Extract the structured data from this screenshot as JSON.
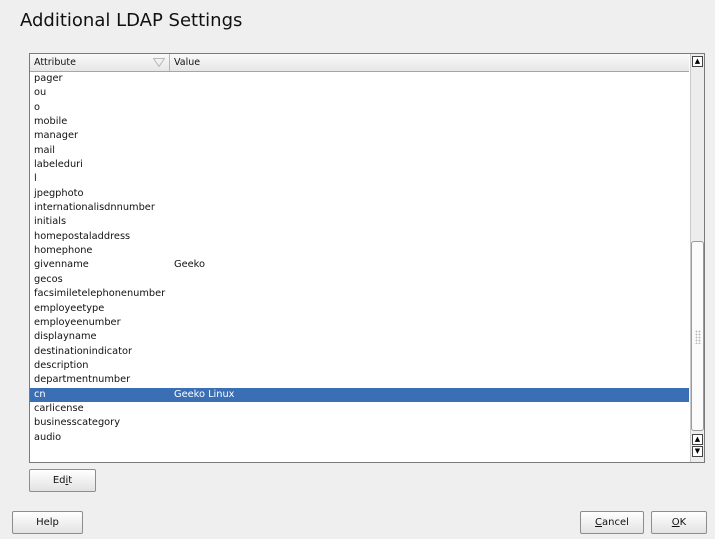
{
  "dialog": {
    "title": "Additional LDAP Settings"
  },
  "table": {
    "columns": [
      "Attribute",
      "Value"
    ],
    "rows": [
      {
        "attribute": "pager",
        "value": ""
      },
      {
        "attribute": "ou",
        "value": ""
      },
      {
        "attribute": "o",
        "value": ""
      },
      {
        "attribute": "mobile",
        "value": ""
      },
      {
        "attribute": "manager",
        "value": ""
      },
      {
        "attribute": "mail",
        "value": ""
      },
      {
        "attribute": "labeleduri",
        "value": ""
      },
      {
        "attribute": "l",
        "value": ""
      },
      {
        "attribute": "jpegphoto",
        "value": ""
      },
      {
        "attribute": "internationalisdnnumber",
        "value": ""
      },
      {
        "attribute": "initials",
        "value": ""
      },
      {
        "attribute": "homepostaladdress",
        "value": ""
      },
      {
        "attribute": "homephone",
        "value": ""
      },
      {
        "attribute": "givenname",
        "value": "Geeko"
      },
      {
        "attribute": "gecos",
        "value": ""
      },
      {
        "attribute": "facsimiletelephonenumber",
        "value": ""
      },
      {
        "attribute": "employeetype",
        "value": ""
      },
      {
        "attribute": "employeenumber",
        "value": ""
      },
      {
        "attribute": "displayname",
        "value": ""
      },
      {
        "attribute": "destinationindicator",
        "value": ""
      },
      {
        "attribute": "description",
        "value": ""
      },
      {
        "attribute": "departmentnumber",
        "value": ""
      },
      {
        "attribute": "cn",
        "value": "Geeko Linux"
      },
      {
        "attribute": "carlicense",
        "value": ""
      },
      {
        "attribute": "businesscategory",
        "value": ""
      },
      {
        "attribute": "audio",
        "value": ""
      }
    ],
    "selected_index": 22,
    "sort_icon": "sort-descending-icon",
    "selection_color": "#3a6fb5"
  },
  "buttons": {
    "edit": {
      "pre": "Ed",
      "mnemonic": "i",
      "post": "t"
    },
    "help": {
      "label": "Help"
    },
    "cancel": {
      "mnemonic": "C",
      "rest": "ancel"
    },
    "ok": {
      "mnemonic": "O",
      "rest": "K"
    }
  }
}
